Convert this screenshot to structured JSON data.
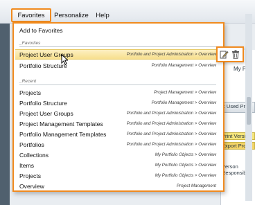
{
  "menubar": {
    "favorites": "Favorites",
    "personalize": "Personalize",
    "help": "Help"
  },
  "background": {
    "frag_my": "My Po",
    "frag_last_used": "st Used Pr",
    "frag_print": "Print Version",
    "frag_export": "Export Proje",
    "frag_person": "Person",
    "frag_responsible": "Responsib"
  },
  "dropdown": {
    "add_to_favorites": "Add to Favorites",
    "favorites_section": "_Favorites",
    "favorites": [
      {
        "label": "Project User Groups",
        "path": "Portfolio and Project Administration > Overview"
      },
      {
        "label": "Portfolio Structure",
        "path": "Portfolio Management > Overview"
      }
    ],
    "recent_section": "_Recent",
    "recent": [
      {
        "label": "Projects",
        "path": "Project Management > Overview"
      },
      {
        "label": "Portfolio Structure",
        "path": "Portfolio Management > Overview"
      },
      {
        "label": "Project User Groups",
        "path": "Portfolio and Project Administration > Overview"
      },
      {
        "label": "Project Management Templates",
        "path": "Portfolio and Project Administration > Overview"
      },
      {
        "label": "Portfolio Management Templates",
        "path": "Portfolio and Project Administration > Overview"
      },
      {
        "label": "Portfolios",
        "path": "Portfolio and Project Administration > Overview"
      },
      {
        "label": "Collections",
        "path": "My Portfolio Objects > Overview"
      },
      {
        "label": "Items",
        "path": "My Portfolio Objects > Overview"
      },
      {
        "label": "Projects",
        "path": "My Portfolio Objects > Overview"
      },
      {
        "label": "Overview",
        "path": "Project Management"
      }
    ]
  },
  "colors": {
    "highlight_border": "#f08a1e",
    "hover_row": "#f7df8d"
  }
}
